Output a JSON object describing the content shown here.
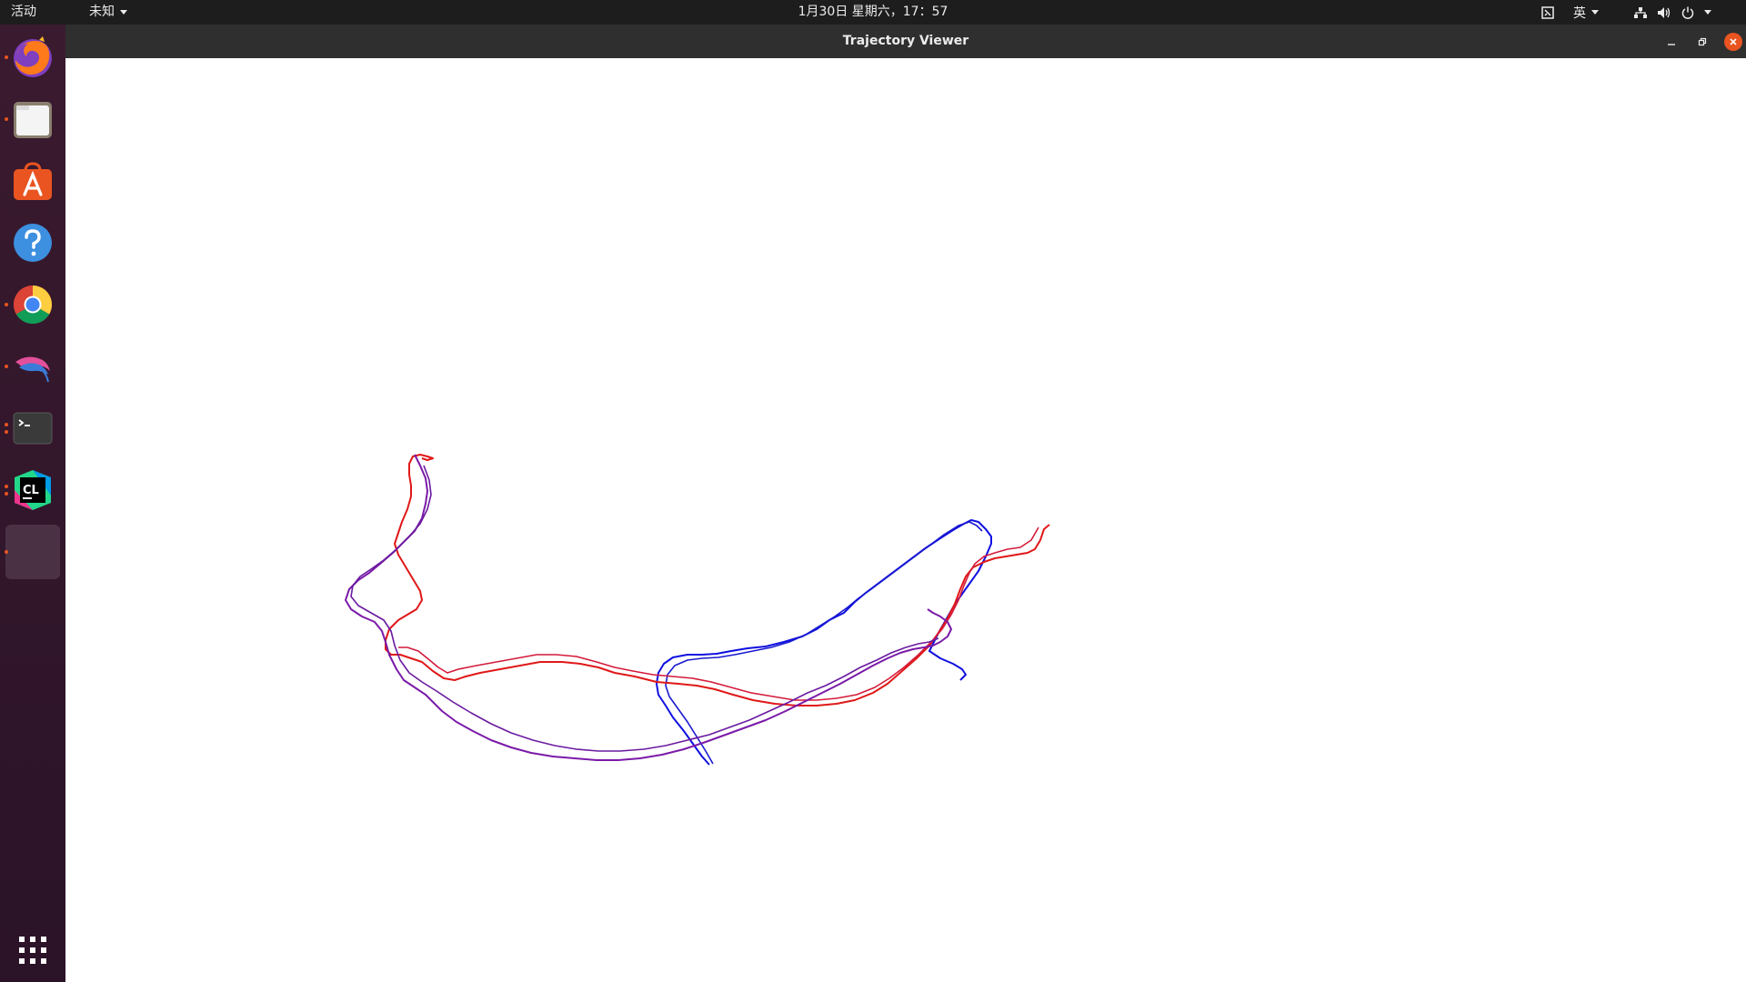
{
  "topbar": {
    "activities": "活动",
    "app_menu": "未知",
    "clock": "1月30日 星期六，17：57",
    "input_method": "英"
  },
  "dock": {
    "apps": [
      {
        "name": "firefox",
        "running": true
      },
      {
        "name": "files",
        "running": true
      },
      {
        "name": "software",
        "running": false
      },
      {
        "name": "help",
        "running": false
      },
      {
        "name": "chrome",
        "running": true
      },
      {
        "name": "kali",
        "running": true
      },
      {
        "name": "terminal",
        "running": true
      },
      {
        "name": "clion",
        "running": true
      },
      {
        "name": "trajectory-viewer",
        "running": true
      }
    ]
  },
  "window": {
    "title": "Trajectory Viewer"
  },
  "colors": {
    "topbar": "#1d1d1d",
    "titlebar": "#2f2f2f",
    "accent": "#e95420",
    "trajectory_a": "#1010e0",
    "trajectory_b": "#e01818",
    "trajectory_c": "#7a1aa8"
  }
}
